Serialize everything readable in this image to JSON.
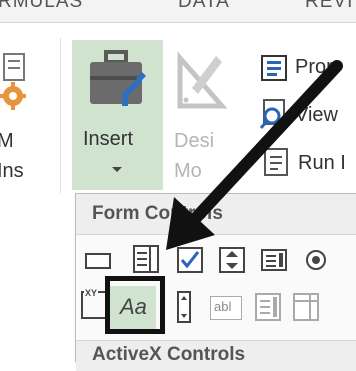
{
  "tabs": [
    "RMULAS",
    "DATA",
    "REVI"
  ],
  "ribbon": {
    "addins_label_line1": "M",
    "addins_label_line2": "Ins",
    "insert_label": "Insert",
    "design_mode_line1": "Desi",
    "design_mode_line2": "Mo",
    "properties_label": "Prop",
    "view_code_label": "View",
    "run_dialog_label": "Run I"
  },
  "dropdown": {
    "form_controls_title": "Form Controls",
    "label_control_text": "Aa",
    "textfield_text": "abl",
    "activex_title": "ActiveX Controls"
  },
  "colors": {
    "insert_highlight": "#cfe3cf",
    "callout_box": "#111111",
    "arrow": "#111111",
    "checkbox_blue": "#2a64b8"
  }
}
